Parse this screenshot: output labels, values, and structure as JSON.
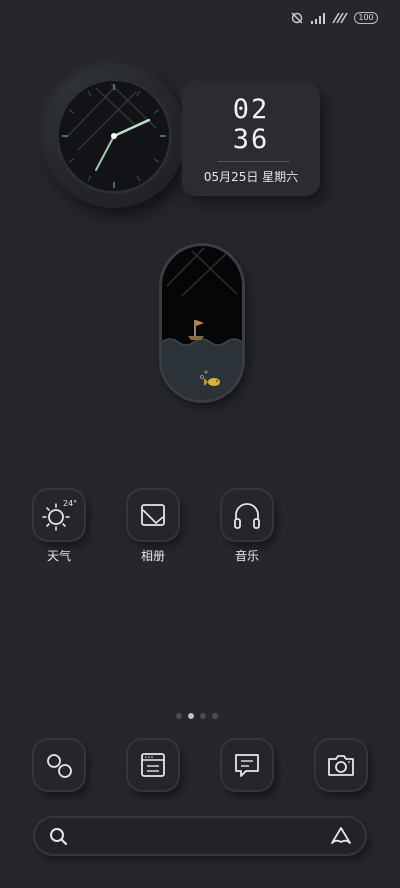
{
  "status_bar": {
    "icons": [
      "sync-off-icon",
      "signal-icon",
      "no-sim-icon",
      "battery-icon"
    ],
    "battery_level": "100"
  },
  "clock_widget": {
    "hour": "02",
    "minute": "36",
    "date": "05月25日 星期六"
  },
  "sea_widget": {
    "icons": [
      "sailboat-icon",
      "fish-icon"
    ],
    "accent_colors": {
      "flag": "#e07a2b",
      "fish": "#d9b23a",
      "water": "#2b3238"
    }
  },
  "apps": [
    {
      "label": "天气",
      "icon": "weather-sun-icon",
      "temp": "24°"
    },
    {
      "label": "相册",
      "icon": "gallery-icon"
    },
    {
      "label": "音乐",
      "icon": "headphones-icon"
    }
  ],
  "page_indicator": {
    "count": 4,
    "active_index": 1
  },
  "dock": [
    {
      "icon": "browser-orbit-icon"
    },
    {
      "icon": "notes-icon"
    },
    {
      "icon": "messages-icon"
    },
    {
      "icon": "camera-icon"
    }
  ],
  "search_bar": {
    "left_icon": "search-icon",
    "right_icon": "assistant-logo-icon"
  }
}
